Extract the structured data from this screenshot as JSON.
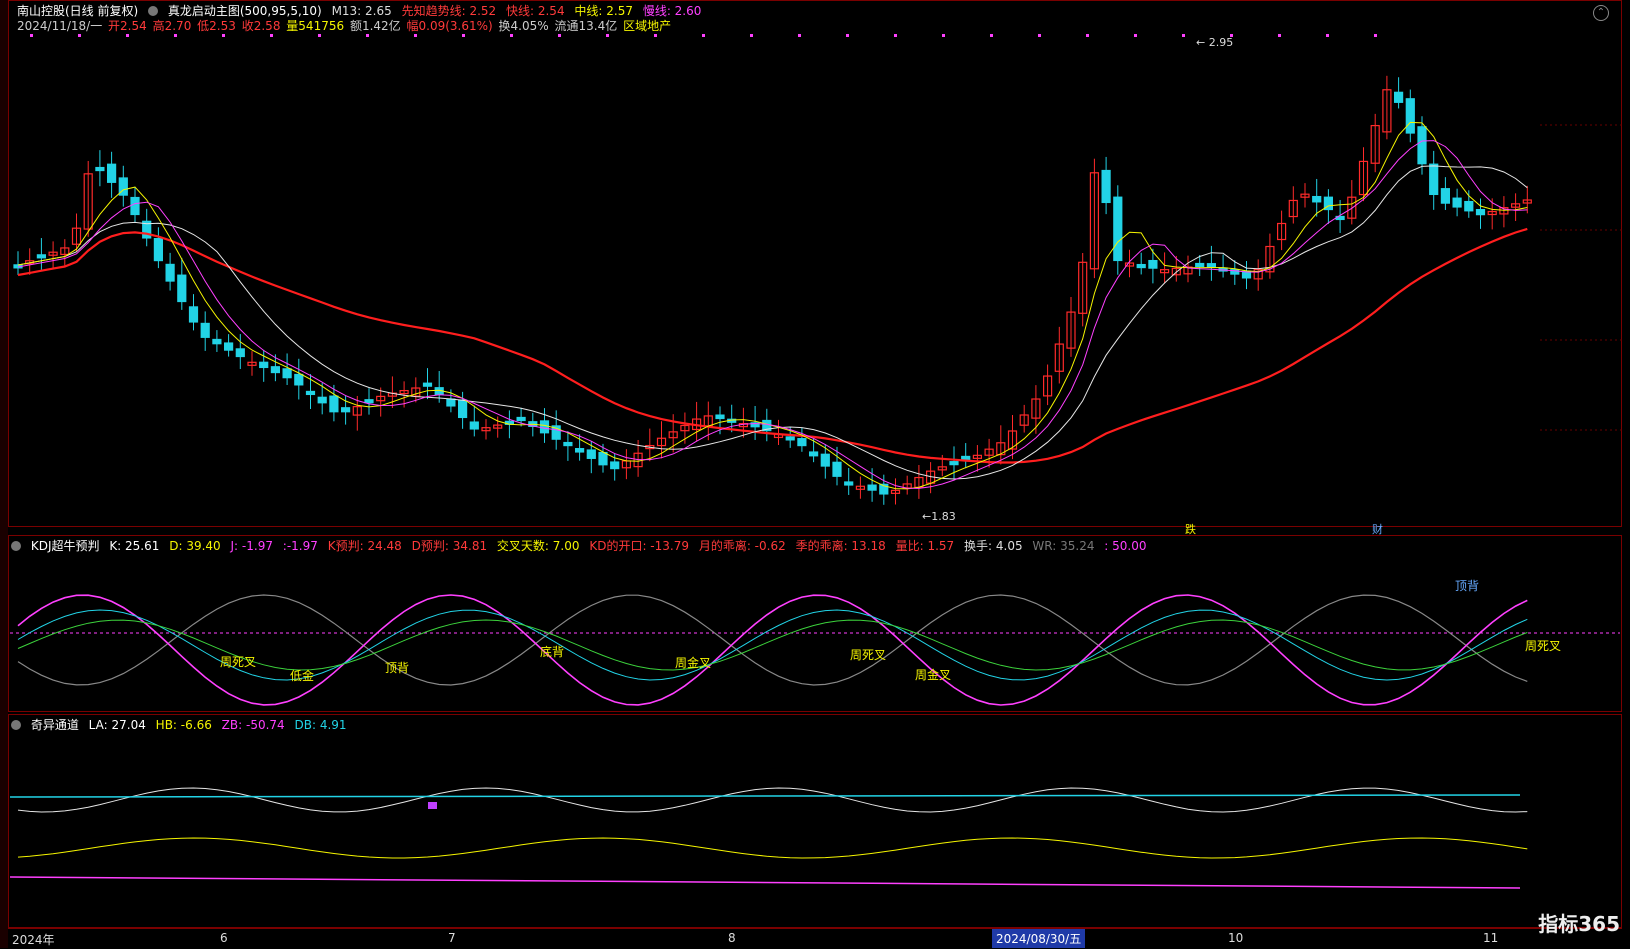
{
  "main": {
    "stock_name": "南山控股(日线 前复权)",
    "indicator": "真龙启动主图(500,95,5,10)",
    "m13": "M13: 2.65",
    "line1": "先知趋势线: 2.52",
    "line2": "快线: 2.54",
    "line3": "中线: 2.57",
    "line4": "慢线: 2.60",
    "date": "2024/11/18/一",
    "open": "开2.54",
    "high": "高2.70",
    "low": "低2.53",
    "close": "收2.58",
    "volume": "量541756",
    "amount": "额1.42亿",
    "change": "幅0.09(3.61%)",
    "turnover": "换4.05%",
    "float": "流通13.4亿",
    "sector": "区域地产",
    "peak_label": "2.95",
    "trough_label": "1.83",
    "annotation_1": "跌",
    "annotation_2": "财"
  },
  "kdj": {
    "title": "KDJ超牛预判",
    "k": "K: 25.61",
    "d": "D: 39.40",
    "j": "J: -1.97",
    "extra": ":-1.97",
    "k_pred": "K预判: 24.48",
    "d_pred": "D预判: 34.81",
    "cross_days": "交叉天数: 7.00",
    "kd_open": "KD的开口: -13.79",
    "month_dev": "月的乖离: -0.62",
    "season_dev": "季的乖离: 13.18",
    "vol_ratio": "量比: 1.57",
    "turnover": "换手: 4.05",
    "wr": "WR: 35.24",
    "fifty": ": 50.00",
    "labels": [
      "周死叉",
      "低金",
      "顶背",
      "底背",
      "周金叉",
      "周死叉",
      "周金叉",
      "顶背",
      "周死叉"
    ]
  },
  "channel": {
    "title": "奇异通道",
    "la": "LA: 27.04",
    "hb": "HB: -6.66",
    "zb": "ZB: -50.74",
    "db": "DB: 4.91"
  },
  "axis": {
    "ticks": [
      "2024年",
      "6",
      "7",
      "8",
      "2024/08/30/五",
      "10",
      "11"
    ],
    "watermark": "指标365"
  },
  "colors": {
    "up": "#ff2a2a",
    "down": "#22d3e6",
    "ma_red": "#ff1e1e",
    "ma_white": "#e6e6e6",
    "ma_yellow": "#f5f500",
    "ma_magenta": "#ff40ff"
  }
}
